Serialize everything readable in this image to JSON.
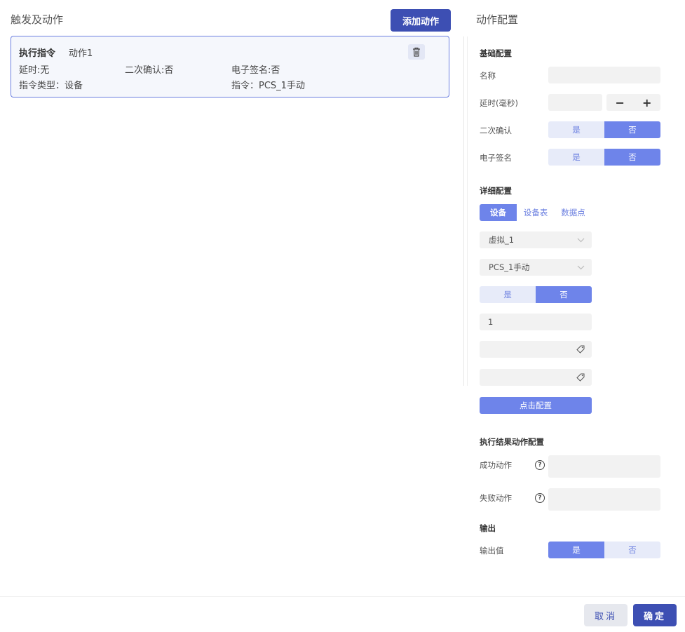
{
  "left": {
    "title": "触发及动作",
    "add_action_label": "添加动作",
    "action_card": {
      "type_label": "执行指令",
      "name": "动作1",
      "delay": "延时:无",
      "second_confirm": "二次确认:否",
      "esign": "电子签名:否",
      "command_type": "指令类型：设备",
      "command": "指令：PCS_1手动"
    }
  },
  "right": {
    "title": "动作配置",
    "basic": {
      "section_label": "基础配置",
      "name_label": "名称",
      "name_value": "",
      "delay_label": "延时(毫秒)",
      "delay_value": "",
      "minus": "−",
      "plus": "+",
      "second_confirm_label": "二次确认",
      "esign_label": "电子签名",
      "yes": "是",
      "no": "否"
    },
    "detail": {
      "section_label": "详细配置",
      "tabs": [
        "设备",
        "设备表",
        "数据点"
      ],
      "active_tab": "设备",
      "device_select": "虚拟_1",
      "command_select": "PCS_1手动",
      "toggle_yes": "是",
      "toggle_no": "否",
      "value_input": "1",
      "tag_input_1": "",
      "tag_input_2": "",
      "click_config_label": "点击配置"
    },
    "result": {
      "section_label": "执行结果动作配置",
      "success_label": "成功动作",
      "fail_label": "失败动作",
      "help_glyph": "?"
    },
    "output": {
      "section_label": "输出",
      "value_label": "输出值",
      "yes": "是",
      "no": "否"
    }
  },
  "footer": {
    "cancel_label": "取消",
    "ok_label": "确定"
  },
  "colors": {
    "primary": "#3d4fb3",
    "accent": "#6e84ea",
    "accent_light": "#e7ebf9",
    "card_border": "#6b7fe0"
  }
}
